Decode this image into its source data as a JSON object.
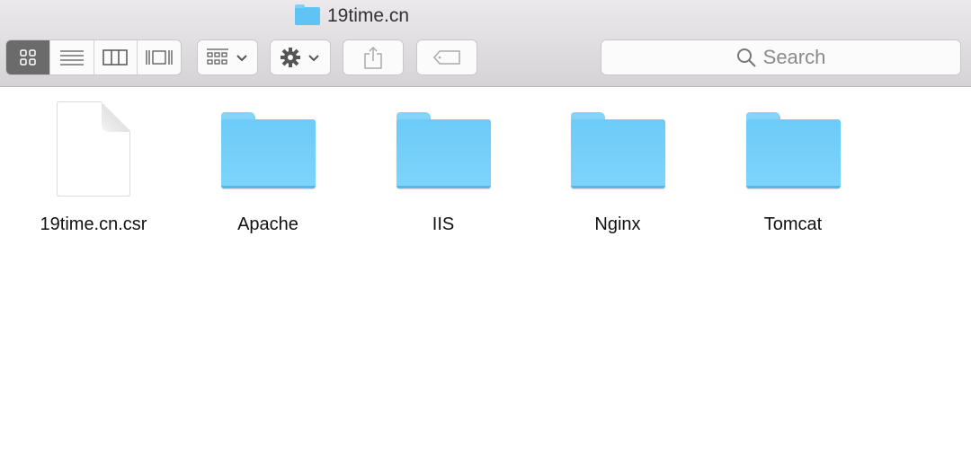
{
  "window": {
    "title": "19time.cn"
  },
  "toolbar": {
    "view_modes": [
      {
        "name": "icon-view",
        "glyph": "▫▫"
      },
      {
        "name": "list-view",
        "glyph": "☰"
      },
      {
        "name": "column-view",
        "glyph": "◫"
      },
      {
        "name": "cover-flow-view",
        "glyph": "⫼"
      }
    ],
    "arrange_glyph": "▦ ⌄",
    "action_glyph": "✹ ⌄",
    "share_glyph": "⇧",
    "tag_glyph": "⬭"
  },
  "search": {
    "placeholder": "Search"
  },
  "items": [
    {
      "name": "19time.cn.csr",
      "kind": "document"
    },
    {
      "name": "Apache",
      "kind": "folder"
    },
    {
      "name": "IIS",
      "kind": "folder"
    },
    {
      "name": "Nginx",
      "kind": "folder"
    },
    {
      "name": "Tomcat",
      "kind": "folder"
    }
  ],
  "colors": {
    "folder": "#6ccbf7",
    "selected_segment": "#6b6b6b"
  }
}
